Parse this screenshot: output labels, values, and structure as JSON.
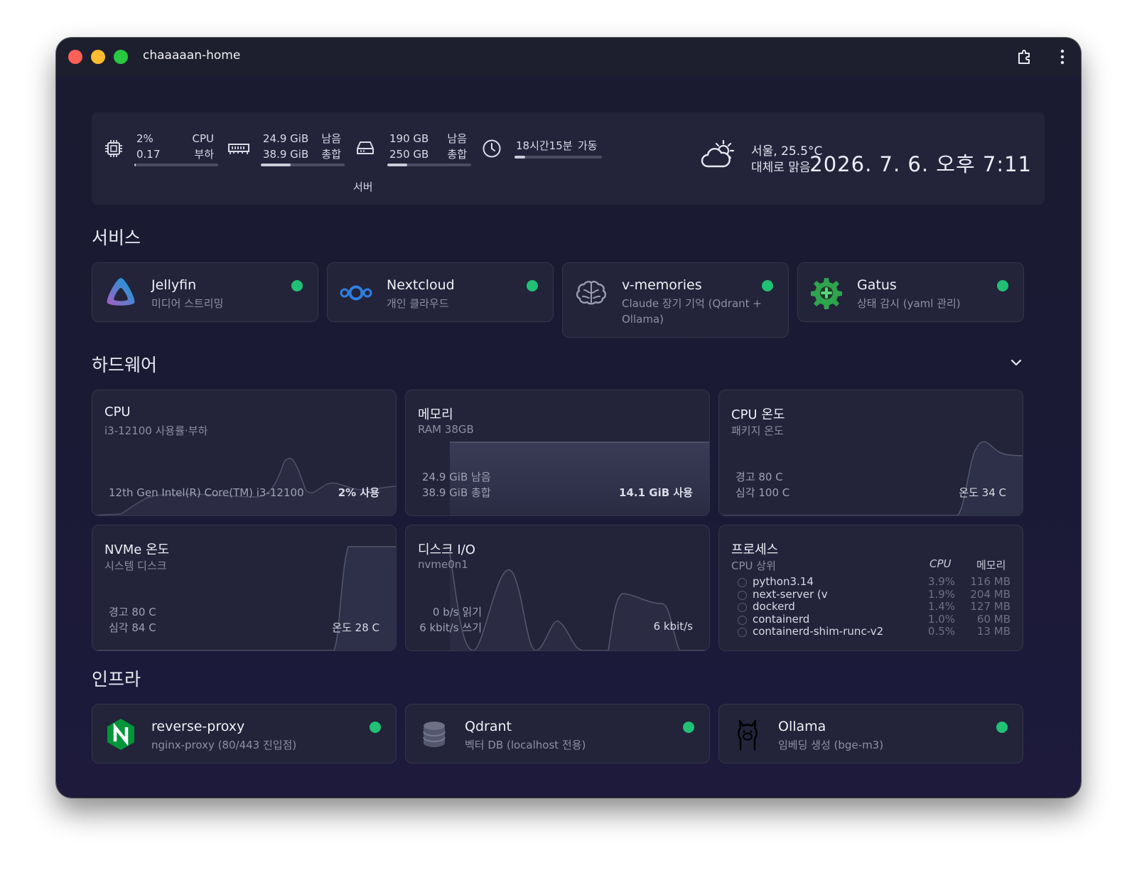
{
  "window": {
    "title": "chaaaaan-home"
  },
  "stats": {
    "cpu": {
      "percent": "2%",
      "load": "0.17",
      "label1": "CPU",
      "label2": "부하",
      "usage": 0.02
    },
    "memory": {
      "free": "24.9 GiB",
      "total": "38.9 GiB",
      "label1": "남음",
      "label2": "총합",
      "usage": 0.36
    },
    "disk": {
      "free": "190 GB",
      "total": "250 GB",
      "label1": "남음",
      "label2": "총합",
      "usage": 0.24
    },
    "uptime": {
      "value": "18시간15분",
      "label": "가동",
      "usage": 0.12
    },
    "server_label": "서버",
    "weather": {
      "location_temp": "서울, 25.5°C",
      "condition": "대체로 맑음",
      "icon": "partly-cloudy-icon"
    },
    "datetime": "2026. 7. 6. 오후 7:11"
  },
  "sections": {
    "services": "서비스",
    "hardware": "하드웨어",
    "infra": "인프라"
  },
  "services": [
    {
      "name": "Jellyfin",
      "desc": "미디어 스트리밍",
      "icon": "jellyfin-icon",
      "status": "online"
    },
    {
      "name": "Nextcloud",
      "desc": "개인 클라우드",
      "icon": "nextcloud-icon",
      "status": "online"
    },
    {
      "name": "v-memories",
      "desc": "Claude 장기 기억 (Qdrant + Ollama)",
      "icon": "brain-icon",
      "status": "online"
    },
    {
      "name": "Gatus",
      "desc": "상태 감시 (yaml 관리)",
      "icon": "gear-icon",
      "status": "online"
    }
  ],
  "hardware": {
    "cpu": {
      "title": "CPU",
      "sub": "i3-12100 사용률·부하",
      "left": "12th Gen Intel(R) Core(TM) i3-12100",
      "right": "2% 사용"
    },
    "memory": {
      "title": "메모리",
      "sub": "RAM 38GB",
      "left1": "24.9 GiB 남음",
      "left2": "38.9 GiB 총합",
      "right": "14.1 GiB 사용"
    },
    "cpu_temp": {
      "title": "CPU 온도",
      "sub": "패키지 온도",
      "left1": "경고 80 C",
      "left2": "심각 100 C",
      "right": "온도 34 C"
    },
    "nvme_temp": {
      "title": "NVMe 온도",
      "sub": "시스템 디스크",
      "left1": "경고 80 C",
      "left2": "심각 84 C",
      "right": "온도 28 C"
    },
    "disk_io": {
      "title": "디스크 I/O",
      "sub": "nvme0n1",
      "left1": "0 b/s 읽기",
      "left2": "6 kbit/s 쓰기",
      "right": "6 kbit/s"
    },
    "processes": {
      "title": "프로세스",
      "sub": "CPU 상위",
      "col_cpu": "CPU",
      "col_mem": "메모리",
      "rows": [
        {
          "name": "python3.14",
          "cpu": "3.9%",
          "mem": "116 MB"
        },
        {
          "name": "next-server (v",
          "cpu": "1.9%",
          "mem": "204 MB"
        },
        {
          "name": "dockerd",
          "cpu": "1.4%",
          "mem": "127 MB"
        },
        {
          "name": "containerd",
          "cpu": "1.0%",
          "mem": "60 MB"
        },
        {
          "name": "containerd-shim-runc-v2",
          "cpu": "0.5%",
          "mem": "13 MB"
        }
      ]
    }
  },
  "infra": [
    {
      "name": "reverse-proxy",
      "desc": "nginx-proxy (80/443 진입점)",
      "icon": "nginx-icon",
      "status": "online"
    },
    {
      "name": "Qdrant",
      "desc": "벡터 DB (localhost 전용)",
      "icon": "database-icon",
      "status": "online"
    },
    {
      "name": "Ollama",
      "desc": "임베딩 생성 (bge-m3)",
      "icon": "llama-icon",
      "status": "online"
    }
  ],
  "colors": {
    "online": "#20c075",
    "background": "#1b1a36",
    "card": "#23233a"
  }
}
